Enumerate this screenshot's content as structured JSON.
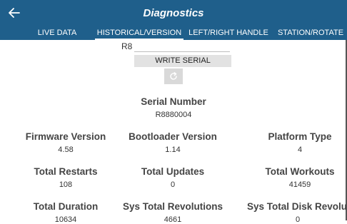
{
  "header": {
    "title": "Diagnostics",
    "back_icon": "arrow-left-icon",
    "color": "#1f5f8b"
  },
  "tabs": [
    {
      "label": "LIVE DATA",
      "selected": false
    },
    {
      "label": "HISTORICAL/VERSION",
      "selected": true
    },
    {
      "label": "LEFT/RIGHT HANDLE",
      "selected": false
    },
    {
      "label": "STATION/ROTATE",
      "selected": false
    }
  ],
  "serial_form": {
    "prefix": "R8",
    "input_value": "",
    "write_button": "WRITE SERIAL",
    "refresh_icon": "refresh-icon"
  },
  "serial_number": {
    "label": "Serial Number",
    "value": "R8880004"
  },
  "stats": [
    {
      "label": "Firmware Version",
      "value": "4.58"
    },
    {
      "label": "Bootloader Version",
      "value": "1.14"
    },
    {
      "label": "Platform Type",
      "value": "4"
    },
    {
      "label": "Total Restarts",
      "value": "108"
    },
    {
      "label": "Total Updates",
      "value": "0"
    },
    {
      "label": "Total Workouts",
      "value": "41459"
    },
    {
      "label": "Total Duration",
      "value": "10634"
    },
    {
      "label": "Sys Total Revolutions",
      "value": "4661"
    },
    {
      "label": "Sys Total Disk Revolutions",
      "value": "0"
    }
  ]
}
